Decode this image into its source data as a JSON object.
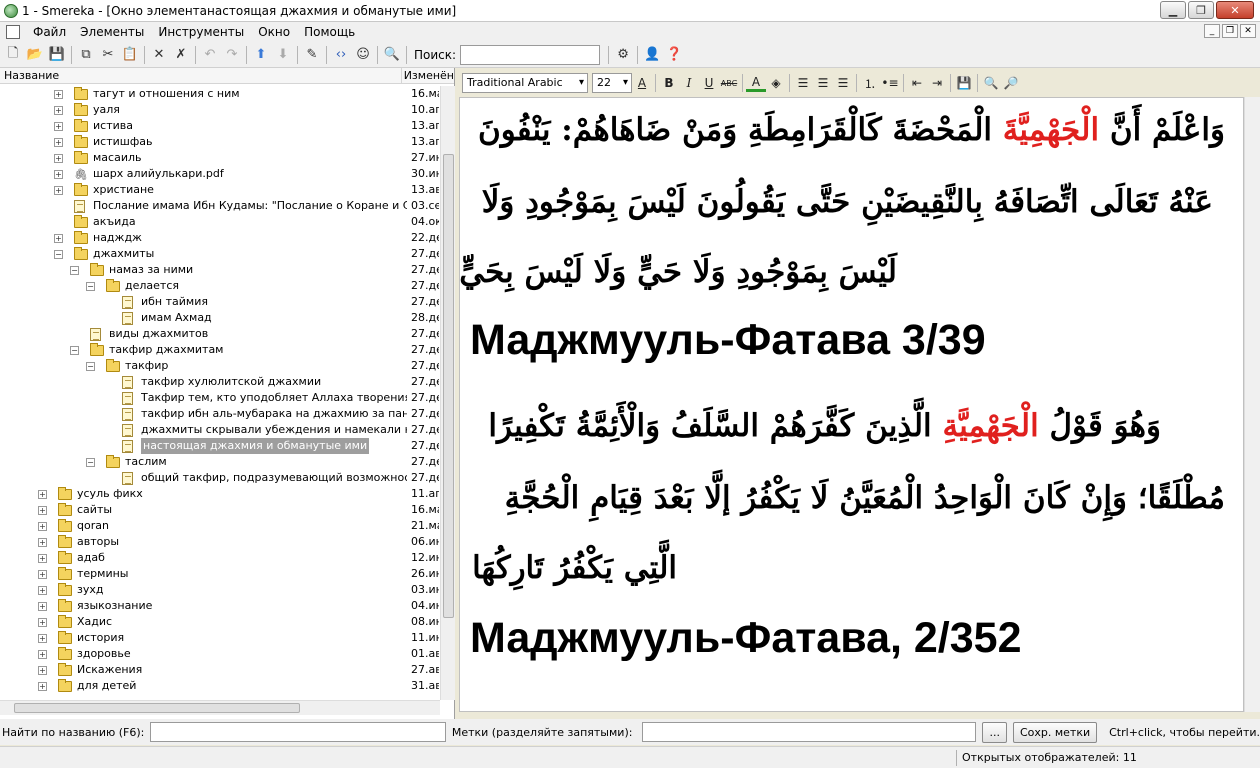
{
  "window": {
    "title": "1 - Smereka - [Окно элементанастоящая джахмия и обманутые ими]"
  },
  "menu": [
    "Файл",
    "Элементы",
    "Инструменты",
    "Окно",
    "Помощь"
  ],
  "toolbar": {
    "search_label": "Поиск:",
    "search_value": ""
  },
  "tree": {
    "col_name": "Название",
    "col_changed": "Изменён",
    "items": [
      {
        "label": "тагут и отношения с ним",
        "date": "16.ма",
        "level": 1,
        "kind": "folder",
        "exp": "+"
      },
      {
        "label": "уаля",
        "date": "10.ап",
        "level": 1,
        "kind": "folder",
        "exp": "+"
      },
      {
        "label": "истива",
        "date": "13.ап",
        "level": 1,
        "kind": "folder",
        "exp": "+"
      },
      {
        "label": "истишфаь",
        "date": "13.ап",
        "level": 1,
        "kind": "folder",
        "exp": "+"
      },
      {
        "label": "масаиль",
        "date": "27.ин",
        "level": 1,
        "kind": "folder",
        "exp": "+"
      },
      {
        "label": "шарх алийулькари.pdf",
        "date": "30.ин",
        "level": 1,
        "kind": "clip",
        "exp": "+"
      },
      {
        "label": "христиане",
        "date": "13.ав",
        "level": 1,
        "kind": "folder",
        "exp": "+"
      },
      {
        "label": "Послание имама Ибн Кудамы: \"Послание о Коране и Словах Аллаха\"",
        "date": "03.се",
        "level": 1,
        "kind": "doc",
        "exp": ""
      },
      {
        "label": "акъида",
        "date": "04.ок",
        "level": 1,
        "kind": "folder",
        "exp": ""
      },
      {
        "label": "надждж",
        "date": "22.де",
        "level": 1,
        "kind": "folder",
        "exp": "+"
      },
      {
        "label": "джахмиты",
        "date": "27.де",
        "level": 1,
        "kind": "folder",
        "exp": "−"
      },
      {
        "label": "намаз за ними",
        "date": "27.де",
        "level": 2,
        "kind": "folder",
        "exp": "−"
      },
      {
        "label": "делается",
        "date": "27.де",
        "level": 3,
        "kind": "folder",
        "exp": "−"
      },
      {
        "label": "ибн таймия",
        "date": "27.де",
        "level": 4,
        "kind": "doc",
        "exp": ""
      },
      {
        "label": "имам Ахмад",
        "date": "28.де",
        "level": 4,
        "kind": "doc",
        "exp": ""
      },
      {
        "label": "виды джахмитов",
        "date": "27.де",
        "level": 2,
        "kind": "doc",
        "exp": ""
      },
      {
        "label": "такфир джахмитам",
        "date": "27.де",
        "level": 2,
        "kind": "folder",
        "exp": "−"
      },
      {
        "label": "такфир",
        "date": "27.де",
        "level": 3,
        "kind": "folder",
        "exp": "−"
      },
      {
        "label": "такфир хулюлитской джахмии",
        "date": "27.де",
        "level": 4,
        "kind": "doc",
        "exp": ""
      },
      {
        "label": "Такфир тем, кто уподобляет Аллаха творениям",
        "date": "27.де",
        "level": 4,
        "kind": "doc",
        "exp": ""
      },
      {
        "label": "такфир ибн аль-мубарака на джахмию за пантеизм",
        "date": "27.де",
        "level": 4,
        "kind": "doc",
        "exp": ""
      },
      {
        "label": "джахмиты скрывали убеждения и намекали на куфр",
        "date": "27.де",
        "level": 4,
        "kind": "doc",
        "exp": ""
      },
      {
        "label": "настоящая джахмия и обманутые ими",
        "date": "27.де",
        "level": 4,
        "kind": "doc",
        "exp": "",
        "selected": true
      },
      {
        "label": "таслим",
        "date": "27.де",
        "level": 3,
        "kind": "folder",
        "exp": "−"
      },
      {
        "label": "общий такфир, подразумевающий возможность ислама",
        "date": "27.де",
        "level": 4,
        "kind": "doc",
        "exp": ""
      },
      {
        "label": "усуль фикх",
        "date": "11.ап",
        "level": 0,
        "kind": "folder",
        "exp": "+"
      },
      {
        "label": "сайты",
        "date": "16.ма",
        "level": 0,
        "kind": "folder",
        "exp": "+"
      },
      {
        "label": "qoran",
        "date": "21.ма",
        "level": 0,
        "kind": "folder",
        "exp": "+"
      },
      {
        "label": "авторы",
        "date": "06.ин",
        "level": 0,
        "kind": "folder",
        "exp": "+"
      },
      {
        "label": "адаб",
        "date": "12.ин",
        "level": 0,
        "kind": "folder",
        "exp": "+"
      },
      {
        "label": "термины",
        "date": "26.ин",
        "level": 0,
        "kind": "folder",
        "exp": "+"
      },
      {
        "label": "зухд",
        "date": "03.ин",
        "level": 0,
        "kind": "folder",
        "exp": "+"
      },
      {
        "label": "языкознание",
        "date": "04.ин",
        "level": 0,
        "kind": "folder",
        "exp": "+"
      },
      {
        "label": "Хадис",
        "date": "08.ин",
        "level": 0,
        "kind": "folder",
        "exp": "+"
      },
      {
        "label": "история",
        "date": "11.ин",
        "level": 0,
        "kind": "folder",
        "exp": "+"
      },
      {
        "label": "здоровье",
        "date": "01.ав",
        "level": 0,
        "kind": "folder",
        "exp": "+"
      },
      {
        "label": "Искажения",
        "date": "27.ав",
        "level": 0,
        "kind": "folder",
        "exp": "+"
      },
      {
        "label": "для детей",
        "date": "31.ав",
        "level": 0,
        "kind": "folder",
        "exp": "+"
      }
    ]
  },
  "editor": {
    "font": "Traditional Arabic",
    "size": "22",
    "p1_line1_a": "وَاعْلَمْ أَنَّ ",
    "p1_line1_red": "الْجَهْمِيَّةَ",
    "p1_line1_b": " الْمَحْضَةَ كَالْقَرَامِطَةِ وَمَنْ ضَاهَاهُمْ: يَنْفُونَ",
    "p1_line2": "عَنْهُ تَعَالَى اتِّصَافَهُ بِالنَّقِيضَيْنِ حَتَّى يَقُولُونَ لَيْسَ بِمَوْجُودِ وَلَا",
    "p1_line3": "لَيْسَ بِمَوْجُودِ وَلَا حَيٍّ وَلَا لَيْسَ بِحَيٍّ",
    "heading1": "Маджмууль-Фатава 3/39",
    "p2_line1_a": "وَهُوَ قَوْلُ ",
    "p2_line1_red": "الْجَهْمِيَّةِ",
    "p2_line1_b": " الَّذِينَ كَفَّرَهُمْ السَّلَفُ وَالْأَئِمَّةُ تَكْفِيرًا",
    "p2_line2": "مُطْلَقًا؛ وَإِنْ كَانَ الْوَاحِدُ الْمُعَيَّنُ لَا يَكْفُرُ إلَّا بَعْدَ قِيَامِ الْحُجَّةِ",
    "p2_line3": "الَّتِي يَكْفُرُ تَارِكُهَا",
    "heading2": "Маджмууль-Фатава, 2/352"
  },
  "bottom": {
    "find_label": "Найти по названию (F6):",
    "tags_label": "Метки (разделяйте запятыми):",
    "ellipsis_button": "...",
    "save_tags_button": "Сохр. метки",
    "hint": "Ctrl+click, чтобы перейти."
  },
  "status": {
    "text": "Открытых отображателей: 11"
  }
}
